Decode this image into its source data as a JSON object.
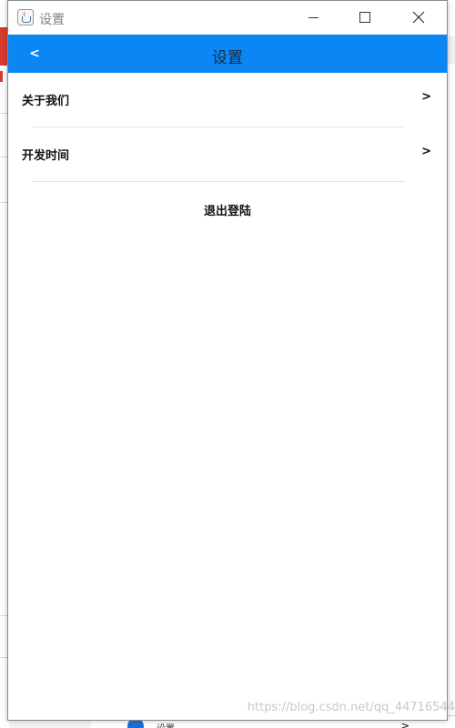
{
  "window": {
    "title": "设置"
  },
  "header": {
    "back_label": "<",
    "title": "设置"
  },
  "settings": {
    "items": [
      {
        "label": "关于我们",
        "chevron": ">"
      },
      {
        "label": "开发时间",
        "chevron": ">"
      }
    ],
    "logout_label": "退出登陆"
  },
  "background_app": {
    "bottom_item_label": "设置",
    "bottom_item_chevron": ">"
  },
  "watermark": "https://blog.csdn.net/qq_44716544",
  "colors": {
    "header_bg": "#0a87f5",
    "accent_red": "#d93a2e"
  },
  "icons": {
    "app": "java-cup-icon",
    "minimize": "minimize-icon",
    "maximize": "maximize-icon",
    "close": "close-icon",
    "back": "chevron-left-icon"
  }
}
